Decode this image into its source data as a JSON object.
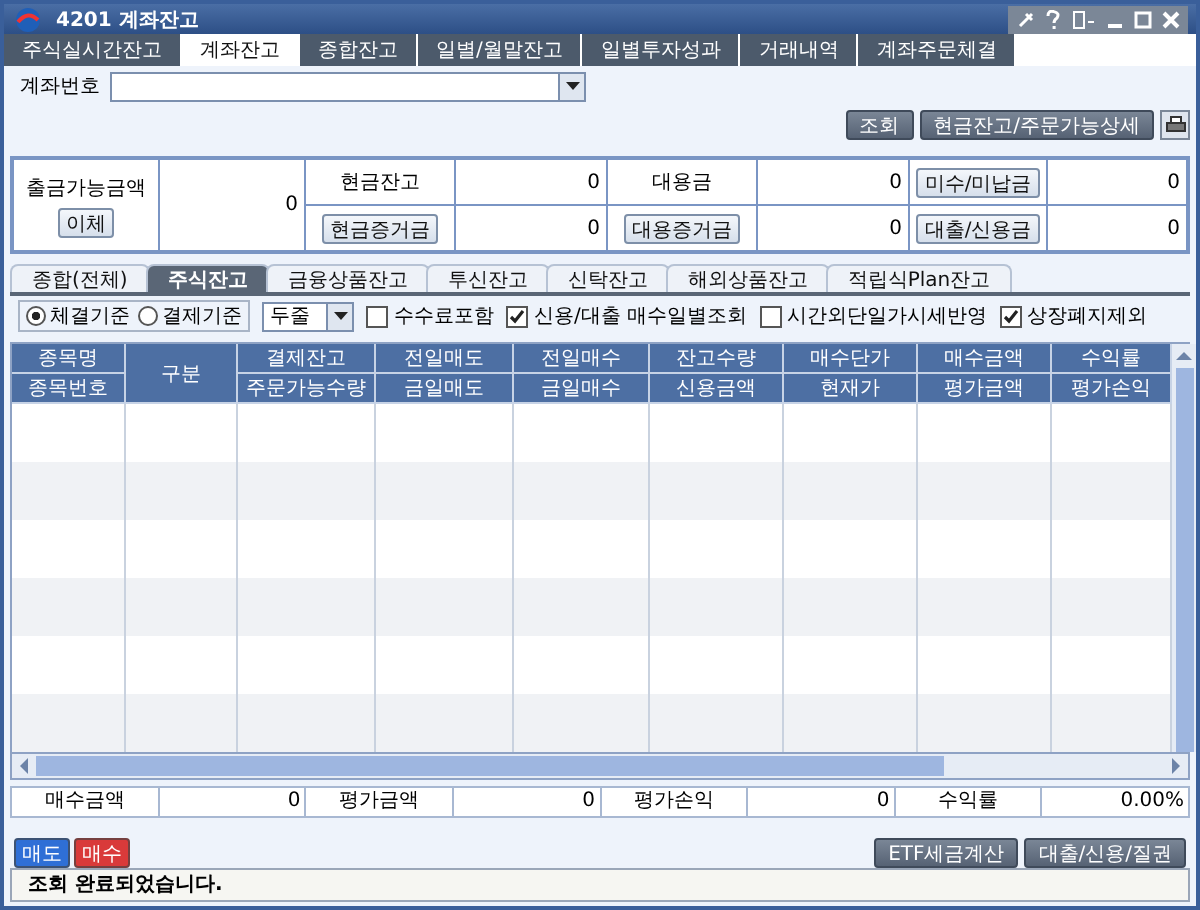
{
  "window": {
    "title": "4201 계좌잔고"
  },
  "tabs": [
    {
      "label": "주식실시간잔고",
      "selected": false
    },
    {
      "label": "계좌잔고",
      "selected": true
    },
    {
      "label": "종합잔고",
      "selected": false
    },
    {
      "label": "일별/월말잔고",
      "selected": false
    },
    {
      "label": "일별투자성과",
      "selected": false
    },
    {
      "label": "거래내역",
      "selected": false
    },
    {
      "label": "계좌주문체결",
      "selected": false
    }
  ],
  "account": {
    "label": "계좌번호"
  },
  "top_buttons": [
    "조회",
    "현금잔고/주문가능상세"
  ],
  "summary": {
    "withdrawable": {
      "label": "출금가능금액",
      "button": "이체",
      "value": "0"
    },
    "rows": [
      [
        {
          "kind": "text",
          "label": "현금잔고",
          "value": "0"
        },
        {
          "kind": "text",
          "label": "대용금",
          "value": "0"
        },
        {
          "kind": "button",
          "label": "미수/미납금",
          "value": "0"
        }
      ],
      [
        {
          "kind": "button",
          "label": "현금증거금",
          "value": "0"
        },
        {
          "kind": "button",
          "label": "대용증거금",
          "value": "0"
        },
        {
          "kind": "button",
          "label": "대출/신용금",
          "value": "0"
        }
      ]
    ]
  },
  "sub_tabs": [
    {
      "label": "종합(전체)",
      "selected": false
    },
    {
      "label": "주식잔고",
      "selected": true
    },
    {
      "label": "금융상품잔고",
      "selected": false
    },
    {
      "label": "투신잔고",
      "selected": false
    },
    {
      "label": "신탁잔고",
      "selected": false
    },
    {
      "label": "해외상품잔고",
      "selected": false
    },
    {
      "label": "적립식Plan잔고",
      "selected": false
    }
  ],
  "options": {
    "radios": [
      {
        "label": "체결기준",
        "selected": true
      },
      {
        "label": "결제기준",
        "selected": false
      }
    ],
    "display": "두줄",
    "checkboxes": [
      {
        "label": "수수료포함",
        "checked": false
      },
      {
        "label": "신용/대출 매수일별조회",
        "checked": true
      },
      {
        "label": "시간외단일가시세반영",
        "checked": false
      },
      {
        "label": "상장폐지제외",
        "checked": true
      }
    ]
  },
  "table": {
    "columns": [
      {
        "top": "종목명",
        "bottom": "종목번호"
      },
      {
        "top": "구분"
      },
      {
        "top": "결제잔고",
        "bottom": "주문가능수량"
      },
      {
        "top": "전일매도",
        "bottom": "금일매도"
      },
      {
        "top": "전일매수",
        "bottom": "금일매수"
      },
      {
        "top": "잔고수량",
        "bottom": "신용금액"
      },
      {
        "top": "매수단가",
        "bottom": "현재가"
      },
      {
        "top": "매수금액",
        "bottom": "평가금액"
      },
      {
        "top": "수익률",
        "bottom": "평가손익"
      }
    ]
  },
  "totals": [
    {
      "label": "매수금액",
      "value": "0"
    },
    {
      "label": "평가금액",
      "value": "0"
    },
    {
      "label": "평가손익",
      "value": "0"
    },
    {
      "label": "수익률",
      "value": "0.00%"
    }
  ],
  "order_buttons": [
    {
      "label": "매도",
      "color": "#2f6fd6"
    },
    {
      "label": "매수",
      "color": "#d93a3a"
    }
  ],
  "action_buttons": [
    "ETF세금계산",
    "대출/신용/질권"
  ],
  "status_bar": {
    "message": "조회 완료되었습니다."
  }
}
